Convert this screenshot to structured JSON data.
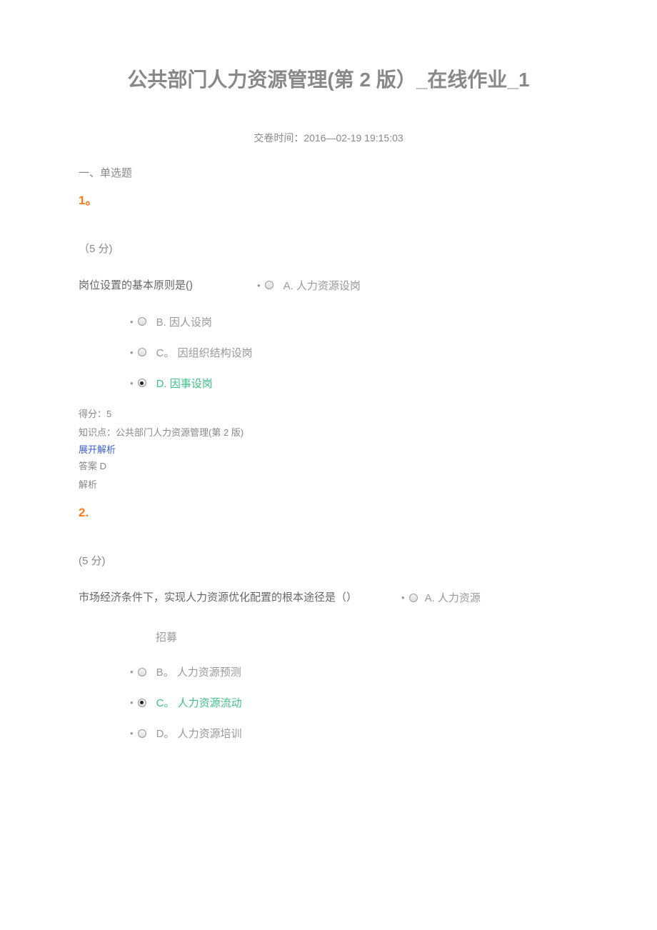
{
  "title": "公共部门人力资源管理(第 2 版）_在线作业_1",
  "submitTime": "交卷时间：2016—02-19 19:15:03",
  "sectionHeading": "一、单选题",
  "q1": {
    "num": "1。",
    "points": "（5 分)",
    "stem": "岗位设置的基本原则是()",
    "optA": "A. 人力资源设岗",
    "optB": "B. 因人设岗",
    "optC": "C。 因组织结构设岗",
    "optD": "D. 因事设岗",
    "score": "得分：5",
    "kp": "知识点：公共部门人力资源管理(第 2 版)",
    "expand": "展开解析",
    "answer": "答案 D",
    "explain": "解析"
  },
  "q2": {
    "num": "2.",
    "points": "(5 分)",
    "stem": "市场经济条件下，实现人力资源优化配置的根本途径是（）",
    "optA": "A. 人力资源",
    "recruit": "招募",
    "optB": "B。 人力资源预测",
    "optC": "C。 人力资源流动",
    "optD": "D。 人力资源培训"
  }
}
